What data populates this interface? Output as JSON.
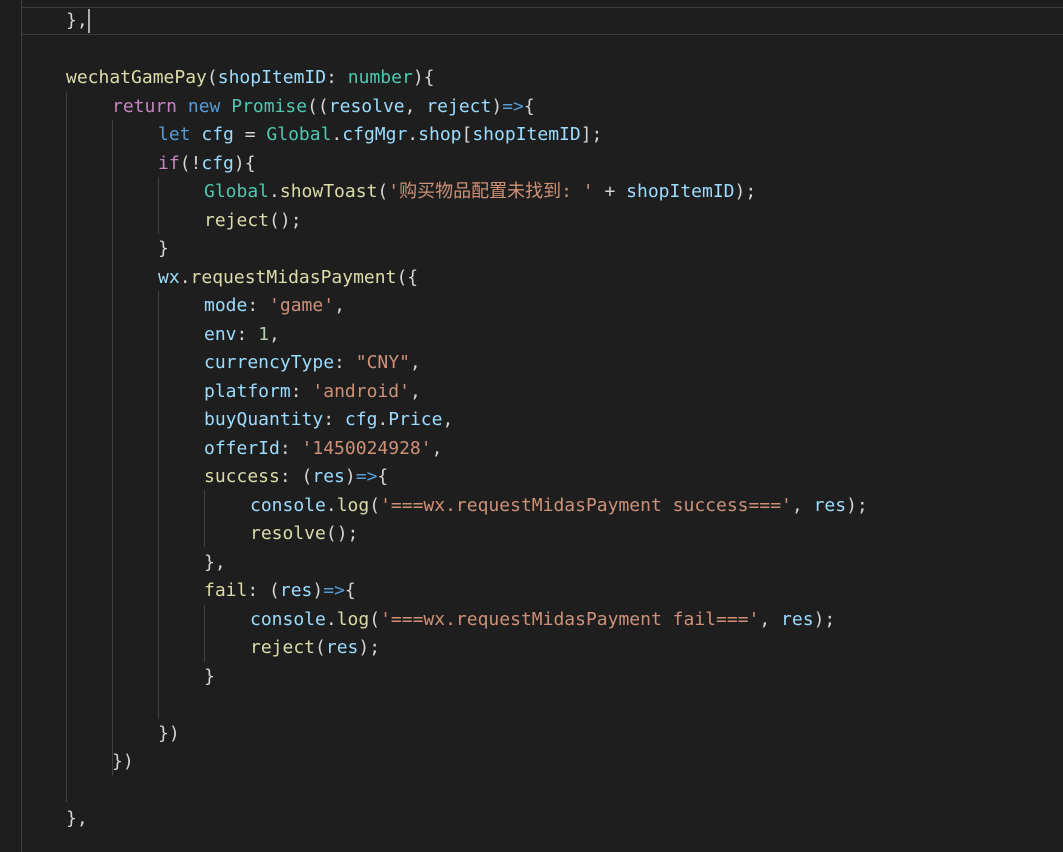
{
  "colors": {
    "background": "#1e1e1e",
    "default": "#d4d4d4",
    "function": "#dcdcaa",
    "parameter": "#9cdcfe",
    "type": "#4ec9b0",
    "keyword": "#569cd6",
    "control": "#c586c0",
    "string": "#ce9178",
    "number": "#b5cea8"
  },
  "lines": [
    {
      "indent": 0,
      "tokens": [
        [
          "},",
          "p"
        ]
      ]
    },
    {
      "indent": 0,
      "tokens": []
    },
    {
      "indent": 0,
      "tokens": [
        [
          "wechatGamePay",
          "fn"
        ],
        [
          "(",
          "p"
        ],
        [
          "shopItemID",
          "pa"
        ],
        [
          ": ",
          "p"
        ],
        [
          "number",
          "ty"
        ],
        [
          "){",
          "p"
        ]
      ]
    },
    {
      "indent": 1,
      "tokens": [
        [
          "return",
          "cf"
        ],
        [
          " ",
          "p"
        ],
        [
          "new",
          "kw"
        ],
        [
          " ",
          "p"
        ],
        [
          "Promise",
          "cl"
        ],
        [
          "((",
          "p"
        ],
        [
          "resolve",
          "pa"
        ],
        [
          ", ",
          "p"
        ],
        [
          "reject",
          "pa"
        ],
        [
          ")",
          "p"
        ],
        [
          "=>",
          "kw"
        ],
        [
          "{",
          "p"
        ]
      ]
    },
    {
      "indent": 2,
      "tokens": [
        [
          "let",
          "kw"
        ],
        [
          " ",
          "p"
        ],
        [
          "cfg",
          "vr"
        ],
        [
          " = ",
          "p"
        ],
        [
          "Global",
          "cl"
        ],
        [
          ".",
          "p"
        ],
        [
          "cfgMgr",
          "vr"
        ],
        [
          ".",
          "p"
        ],
        [
          "shop",
          "vr"
        ],
        [
          "[",
          "p"
        ],
        [
          "shopItemID",
          "vr"
        ],
        [
          "];",
          "p"
        ]
      ]
    },
    {
      "indent": 2,
      "tokens": [
        [
          "if",
          "cf"
        ],
        [
          "(!",
          "p"
        ],
        [
          "cfg",
          "vr"
        ],
        [
          "){",
          "p"
        ]
      ]
    },
    {
      "indent": 3,
      "tokens": [
        [
          "Global",
          "cl"
        ],
        [
          ".",
          "p"
        ],
        [
          "showToast",
          "fn"
        ],
        [
          "(",
          "p"
        ],
        [
          "'购买物品配置未找到: '",
          "st"
        ],
        [
          " + ",
          "p"
        ],
        [
          "shopItemID",
          "vr"
        ],
        [
          ");",
          "p"
        ]
      ]
    },
    {
      "indent": 3,
      "tokens": [
        [
          "reject",
          "fn"
        ],
        [
          "();",
          "p"
        ]
      ]
    },
    {
      "indent": 2,
      "tokens": [
        [
          "}",
          "p"
        ]
      ]
    },
    {
      "indent": 2,
      "tokens": [
        [
          "wx",
          "vr"
        ],
        [
          ".",
          "p"
        ],
        [
          "requestMidasPayment",
          "fn"
        ],
        [
          "({",
          "p"
        ]
      ]
    },
    {
      "indent": 3,
      "tokens": [
        [
          "mode",
          "vr"
        ],
        [
          ": ",
          "p"
        ],
        [
          "'game'",
          "st"
        ],
        [
          ",",
          "p"
        ]
      ]
    },
    {
      "indent": 3,
      "tokens": [
        [
          "env",
          "vr"
        ],
        [
          ": ",
          "p"
        ],
        [
          "1",
          "nu"
        ],
        [
          ",",
          "p"
        ]
      ]
    },
    {
      "indent": 3,
      "tokens": [
        [
          "currencyType",
          "vr"
        ],
        [
          ": ",
          "p"
        ],
        [
          "\"CNY\"",
          "st"
        ],
        [
          ",",
          "p"
        ]
      ]
    },
    {
      "indent": 3,
      "tokens": [
        [
          "platform",
          "vr"
        ],
        [
          ": ",
          "p"
        ],
        [
          "'android'",
          "st"
        ],
        [
          ",",
          "p"
        ]
      ]
    },
    {
      "indent": 3,
      "tokens": [
        [
          "buyQuantity",
          "vr"
        ],
        [
          ": ",
          "p"
        ],
        [
          "cfg",
          "vr"
        ],
        [
          ".",
          "p"
        ],
        [
          "Price",
          "vr"
        ],
        [
          ",",
          "p"
        ]
      ]
    },
    {
      "indent": 3,
      "tokens": [
        [
          "offerId",
          "vr"
        ],
        [
          ": ",
          "p"
        ],
        [
          "'1450024928'",
          "st"
        ],
        [
          ",",
          "p"
        ]
      ]
    },
    {
      "indent": 3,
      "tokens": [
        [
          "success",
          "fn"
        ],
        [
          ": (",
          "p"
        ],
        [
          "res",
          "pa"
        ],
        [
          ")",
          "p"
        ],
        [
          "=>",
          "kw"
        ],
        [
          "{",
          "p"
        ]
      ]
    },
    {
      "indent": 4,
      "tokens": [
        [
          "console",
          "vr"
        ],
        [
          ".",
          "p"
        ],
        [
          "log",
          "fn"
        ],
        [
          "(",
          "p"
        ],
        [
          "'===wx.requestMidasPayment success==='",
          "st"
        ],
        [
          ", ",
          "p"
        ],
        [
          "res",
          "vr"
        ],
        [
          ");",
          "p"
        ]
      ]
    },
    {
      "indent": 4,
      "tokens": [
        [
          "resolve",
          "fn"
        ],
        [
          "();",
          "p"
        ]
      ]
    },
    {
      "indent": 3,
      "tokens": [
        [
          "},",
          "p"
        ]
      ]
    },
    {
      "indent": 3,
      "tokens": [
        [
          "fail",
          "fn"
        ],
        [
          ": (",
          "p"
        ],
        [
          "res",
          "pa"
        ],
        [
          ")",
          "p"
        ],
        [
          "=>",
          "kw"
        ],
        [
          "{",
          "p"
        ]
      ]
    },
    {
      "indent": 4,
      "tokens": [
        [
          "console",
          "vr"
        ],
        [
          ".",
          "p"
        ],
        [
          "log",
          "fn"
        ],
        [
          "(",
          "p"
        ],
        [
          "'===wx.requestMidasPayment fail==='",
          "st"
        ],
        [
          ", ",
          "p"
        ],
        [
          "res",
          "vr"
        ],
        [
          ");",
          "p"
        ]
      ]
    },
    {
      "indent": 4,
      "tokens": [
        [
          "reject",
          "fn"
        ],
        [
          "(",
          "p"
        ],
        [
          "res",
          "vr"
        ],
        [
          ");",
          "p"
        ]
      ]
    },
    {
      "indent": 3,
      "tokens": [
        [
          "}",
          "p"
        ]
      ]
    },
    {
      "indent": 0,
      "tokens": []
    },
    {
      "indent": 2,
      "tokens": [
        [
          "})",
          "p"
        ]
      ]
    },
    {
      "indent": 1,
      "tokens": [
        [
          "})",
          "p"
        ]
      ]
    },
    {
      "indent": 0,
      "tokens": []
    },
    {
      "indent": 0,
      "tokens": [
        [
          "},",
          "p"
        ]
      ]
    }
  ]
}
